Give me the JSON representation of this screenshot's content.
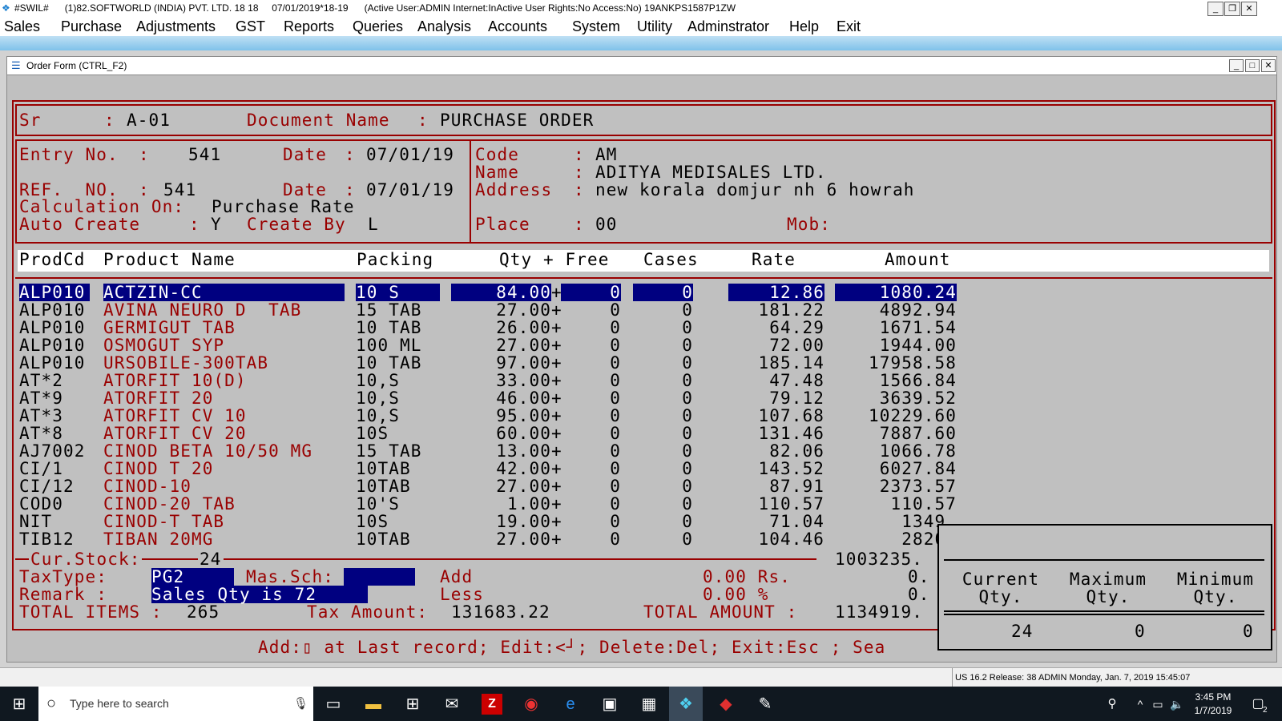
{
  "window": {
    "title": "#SWIL#      (1)82.SOFTWORLD (INDIA) PVT. LTD. 18 18     07/01/2019*18-19      (Active User:ADMIN Internet:InActive User Rights:No Access:No) 19ANKPS1587P1ZW",
    "min": "_",
    "max": "❐",
    "close": "✕"
  },
  "menu": [
    "Sales",
    "Purchase",
    "Adjustments",
    "GST",
    "Reports",
    "Queries",
    "Analysis",
    "Accounts",
    "System",
    "Utility",
    "Adminstrator",
    "Help",
    "Exit"
  ],
  "child": {
    "title": "Order Form (CTRL_F2)",
    "min": "_",
    "max": "□",
    "close": "✕"
  },
  "header": {
    "sr_label": "Sr",
    "sr_value": "A-01",
    "docname_label": "Document Name",
    "docname_value": "PURCHASE ORDER",
    "entry_label": "Entry No.",
    "entry_value": "541",
    "date_label": "Date",
    "date1": "07/01/19",
    "ref_label": "REF.  NO.",
    "ref_value": "541",
    "date2": "07/01/19",
    "calc_label": "Calculation On:",
    "calc_value": "Purchase Rate",
    "auto_label": "Auto Create",
    "auto_value": "Y",
    "createby_label": "Create By",
    "createby_value": "L",
    "code_label": "Code",
    "code_value": "AM",
    "name_label": "Name",
    "name_value": "ADITYA MEDISALES LTD.",
    "address_label": "Address",
    "address_value": "new korala domjur nh 6 howrah",
    "place_label": "Place",
    "place_value": "00",
    "mob_label": "Mob:"
  },
  "columns": [
    "ProdCd",
    "Product Name",
    "Packing",
    "Qty + Free",
    "Cases",
    "Rate",
    "Amount"
  ],
  "rows": [
    {
      "code": "ALP010",
      "name": "ACTZIN-CC",
      "pack": "10 S",
      "qty": "84.00",
      "free": "0",
      "cases": "0",
      "rate": "12.86",
      "amount": "1080.24"
    },
    {
      "code": "ALP010",
      "name": "AVINA NEURO D  TAB",
      "pack": "15 TAB",
      "qty": "27.00",
      "free": "0",
      "cases": "0",
      "rate": "181.22",
      "amount": "4892.94"
    },
    {
      "code": "ALP010",
      "name": "GERMIGUT TAB",
      "pack": "10 TAB",
      "qty": "26.00",
      "free": "0",
      "cases": "0",
      "rate": "64.29",
      "amount": "1671.54"
    },
    {
      "code": "ALP010",
      "name": "OSMOGUT SYP",
      "pack": "100 ML",
      "qty": "27.00",
      "free": "0",
      "cases": "0",
      "rate": "72.00",
      "amount": "1944.00"
    },
    {
      "code": "ALP010",
      "name": "URSOBILE-300TAB",
      "pack": "10 TAB",
      "qty": "97.00",
      "free": "0",
      "cases": "0",
      "rate": "185.14",
      "amount": "17958.58"
    },
    {
      "code": "AT*2",
      "name": "ATORFIT 10(D)",
      "pack": "10,S",
      "qty": "33.00",
      "free": "0",
      "cases": "0",
      "rate": "47.48",
      "amount": "1566.84"
    },
    {
      "code": "AT*9",
      "name": "ATORFIT 20",
      "pack": "10,S",
      "qty": "46.00",
      "free": "0",
      "cases": "0",
      "rate": "79.12",
      "amount": "3639.52"
    },
    {
      "code": "AT*3",
      "name": "ATORFIT CV 10",
      "pack": "10,S",
      "qty": "95.00",
      "free": "0",
      "cases": "0",
      "rate": "107.68",
      "amount": "10229.60"
    },
    {
      "code": "AT*8",
      "name": "ATORFIT CV 20",
      "pack": "10S",
      "qty": "60.00",
      "free": "0",
      "cases": "0",
      "rate": "131.46",
      "amount": "7887.60"
    },
    {
      "code": "AJ7002",
      "name": "CINOD BETA 10/50 MG",
      "pack": "15 TAB",
      "qty": "13.00",
      "free": "0",
      "cases": "0",
      "rate": "82.06",
      "amount": "1066.78"
    },
    {
      "code": "CI/1",
      "name": "CINOD T 20",
      "pack": "10TAB",
      "qty": "42.00",
      "free": "0",
      "cases": "0",
      "rate": "143.52",
      "amount": "6027.84"
    },
    {
      "code": "CI/12",
      "name": "CINOD-10",
      "pack": "10TAB",
      "qty": "27.00",
      "free": "0",
      "cases": "0",
      "rate": "87.91",
      "amount": "2373.57"
    },
    {
      "code": "COD0",
      "name": "CINOD-20 TAB",
      "pack": "10'S",
      "qty": "1.00",
      "free": "0",
      "cases": "0",
      "rate": "110.57",
      "amount": "110.57"
    },
    {
      "code": "NIT",
      "name": "CINOD-T TAB",
      "pack": "10S",
      "qty": "19.00",
      "free": "0",
      "cases": "0",
      "rate": "71.04",
      "amount": "1349."
    },
    {
      "code": "TIB12",
      "name": "TIBAN 20MG",
      "pack": "10TAB",
      "qty": "27.00",
      "free": "0",
      "cases": "0",
      "rate": "104.46",
      "amount": "2820."
    }
  ],
  "footer": {
    "curstock_label": "Cur.Stock:",
    "curstock_value": "24",
    "subtotal": "1003235.",
    "taxtype_label": "TaxType:",
    "taxtype_value": "PG2",
    "massch_label": "Mas.Sch:",
    "add_label": "Add",
    "add_value": "0.00 Rs.",
    "add_amt": "0.",
    "remark_label": "Remark :",
    "remark_value": "Sales Qty is 72",
    "less_label": "Less",
    "less_value": "0.00 %",
    "less_amt": "0.",
    "total_items_label": "TOTAL ITEMS :",
    "total_items_value": "265",
    "tax_label": "Tax Amount:",
    "tax_value": "131683.22",
    "total_amount_label": "TOTAL AMOUNT :",
    "total_amount_value": "1134919.",
    "hint": "Add:▯ at Last record; Edit:<┘; Delete:Del; Exit:Esc ; Sea"
  },
  "stock_panel": {
    "h1a": "Current",
    "h1b": "Qty.",
    "h2a": "Maximum",
    "h2b": "Qty.",
    "h3a": "Minimum",
    "h3b": "Qty.",
    "current": "24",
    "maximum": "0",
    "minimum": "0"
  },
  "status": "US 16.2 Release: 38 ADMIN  Monday, Jan. 7, 2019  15:45:07",
  "taskbar": {
    "search_placeholder": "Type here to search",
    "time": "3:45 PM",
    "date": "1/7/2019",
    "notif": "2"
  }
}
